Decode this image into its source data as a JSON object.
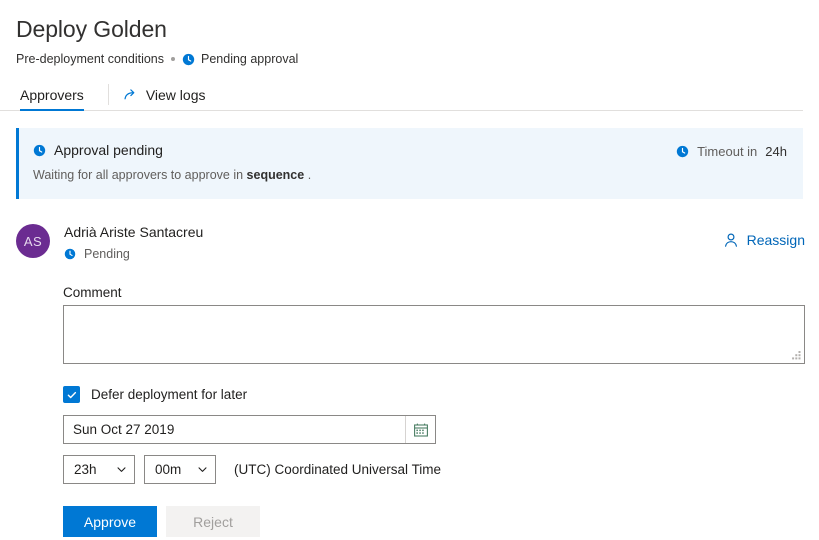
{
  "header": {
    "title": "Deploy Golden",
    "subtitle_text": "Pre-deployment conditions",
    "subtitle_status": "Pending approval",
    "status_icon": "clock-icon"
  },
  "tabs": {
    "items": [
      {
        "label": "Approvers",
        "active": true
      }
    ],
    "view_logs": {
      "label": "View logs",
      "icon": "external-link-icon"
    }
  },
  "banner": {
    "icon": "clock-icon",
    "title": "Approval pending",
    "description_prefix": "Waiting for all approvers to approve in",
    "description_bold": "sequence",
    "description_suffix": ".",
    "timeout_icon": "clock-icon",
    "timeout_label": "Timeout in",
    "timeout_value": "24h",
    "accent_color": "#0078d4",
    "background_color": "#eff6fc"
  },
  "approver": {
    "initials": "AS",
    "avatar_color": "#6b2c91",
    "name": "Adrià Ariste Santacreu",
    "status": "Pending",
    "status_icon": "clock-icon",
    "reassign_label": "Reassign",
    "reassign_icon": "person-icon",
    "link_color": "#0066b8"
  },
  "form": {
    "comment_label": "Comment",
    "comment_value": "",
    "comment_placeholder": "",
    "defer_label": "Defer deployment for later",
    "defer_checked": true,
    "date_value": "Sun Oct 27 2019",
    "date_icon": "calendar-icon",
    "hour_value": "23h",
    "minute_value": "00m",
    "timezone_label": "(UTC) Coordinated Universal Time",
    "approve_label": "Approve",
    "reject_label": "Reject",
    "approve_color": "#0078d4",
    "reject_disabled": true
  }
}
